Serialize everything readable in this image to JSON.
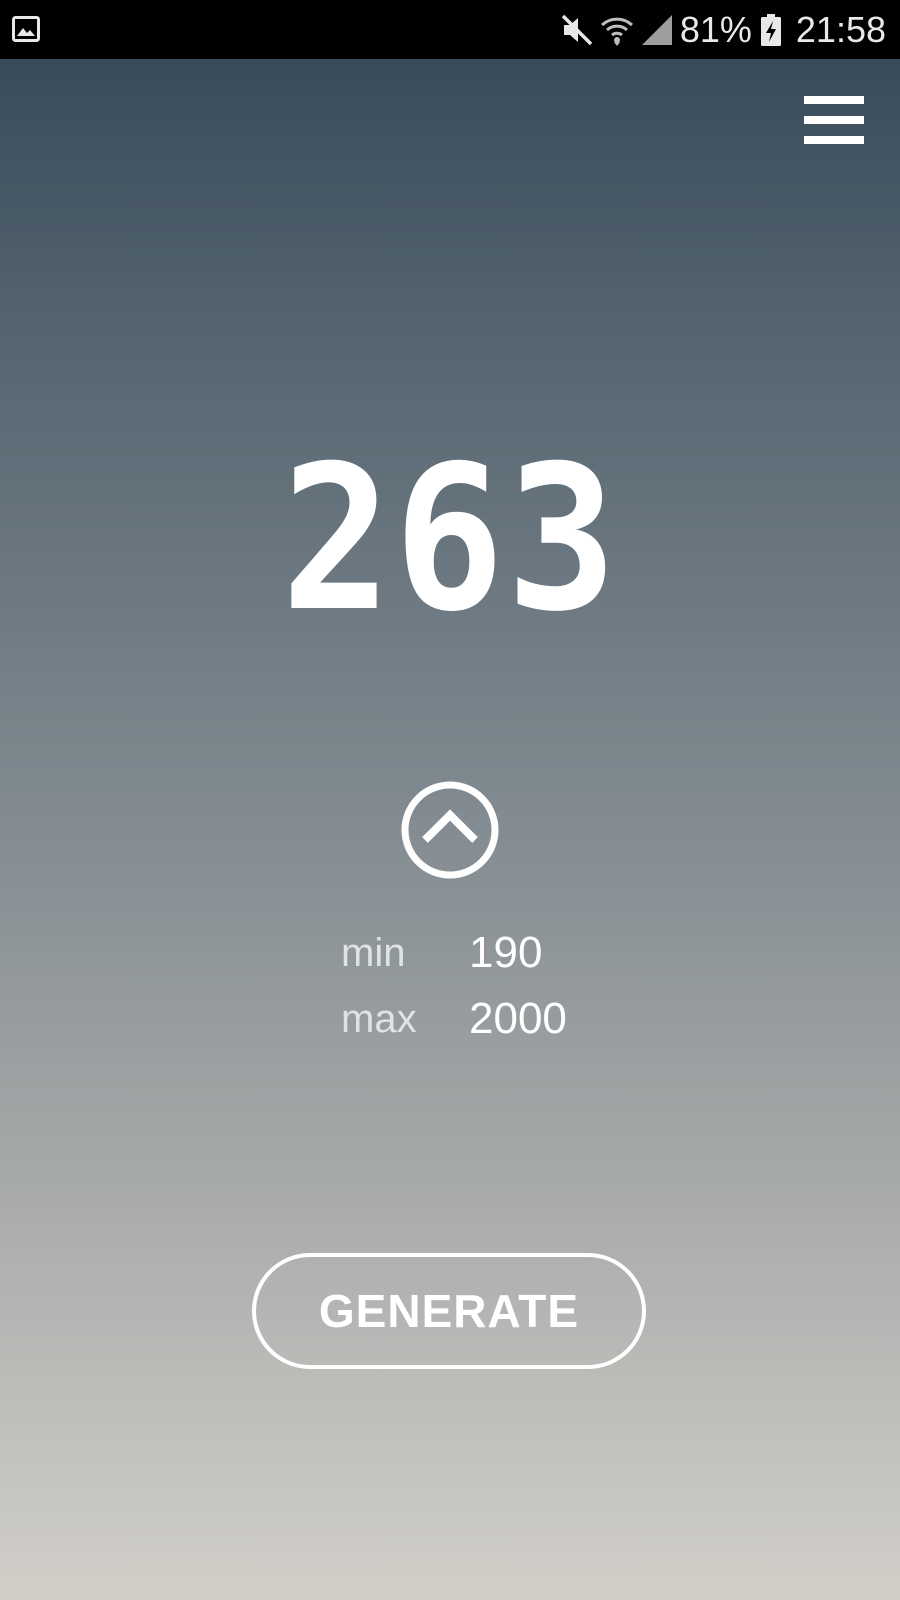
{
  "status_bar": {
    "battery_percent": "81%",
    "time": "21:58",
    "icons": [
      "gallery-icon",
      "mute-icon",
      "wifi-icon",
      "signal-icon",
      "battery-charging-icon"
    ]
  },
  "header": {
    "menu_icon": "hamburger-menu-icon"
  },
  "result": {
    "value": "263"
  },
  "range": {
    "min_label": "min",
    "min_value": "190",
    "max_label": "max",
    "max_value": "2000"
  },
  "actions": {
    "generate_label": "GENERATE",
    "collapse_icon": "chevron-up-circle-icon"
  },
  "colors": {
    "status_bar_bg": "#000000",
    "gradient_top": "#334656",
    "gradient_bottom": "#d2cfc9",
    "foreground": "#ffffff"
  }
}
